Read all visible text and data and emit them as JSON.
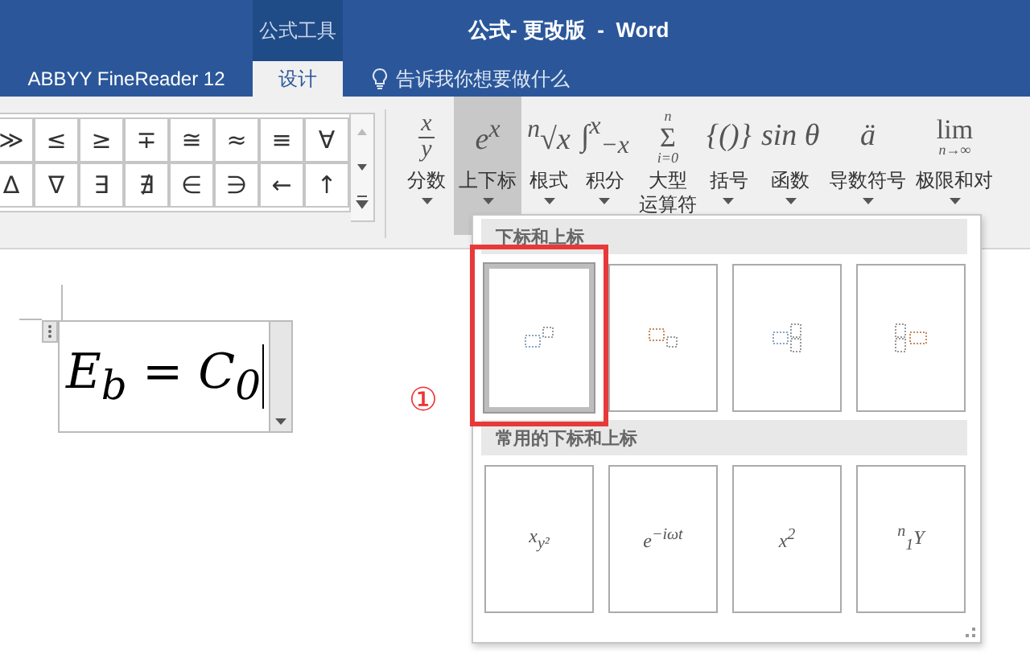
{
  "window": {
    "title": "公式- 更改版  -  Word",
    "context_tab": "公式工具"
  },
  "tabs": [
    {
      "label": "ABBYY FineReader 12",
      "selected": false
    },
    {
      "label": "设计",
      "selected": true
    }
  ],
  "tell_me": {
    "placeholder": "告诉我你想要做什么"
  },
  "symbols": [
    [
      "≫",
      "≤",
      "≥",
      "∓",
      "≅",
      "≈",
      "≡",
      "∀"
    ],
    [
      "∆",
      "∇",
      "∃",
      "∄",
      "∈",
      "∋",
      "←",
      "↑"
    ]
  ],
  "structures": [
    {
      "kind": "fraction",
      "top": "x",
      "bottom": "y",
      "label_lines": [
        "分数"
      ],
      "selected": false
    },
    {
      "kind": "inline",
      "glyph": "e$^{x}$",
      "label_lines": [
        "上下标"
      ],
      "selected": true
    },
    {
      "kind": "inline",
      "glyph": "$^{n}$√x",
      "label_lines": [
        "根式"
      ],
      "selected": false
    },
    {
      "kind": "inline",
      "glyph": "∫$^{x}$$_{−x}$",
      "label_lines": [
        "积分"
      ],
      "selected": false
    },
    {
      "kind": "limits",
      "upper": "n",
      "sign": "Σ",
      "lower": "i=0",
      "label_lines": [
        "大型",
        "运算符"
      ],
      "selected": false
    },
    {
      "kind": "inline",
      "glyph": "{()}",
      "label_lines": [
        "括号"
      ],
      "selected": false
    },
    {
      "kind": "inline",
      "glyph": "sin θ",
      "label_lines": [
        "函数"
      ],
      "selected": false
    },
    {
      "kind": "inline",
      "glyph": "ä",
      "label_lines": [
        "导数符号"
      ],
      "selected": false
    },
    {
      "kind": "limits",
      "sign": "lim",
      "lower": "n→∞",
      "label_lines": [
        "极限和对"
      ],
      "selected": false
    }
  ],
  "equation": "E$_{b}$ = C$_{0}$",
  "marker": "①",
  "dropdown": {
    "sections": [
      {
        "title": "下标和上标",
        "items": [
          {
            "kind": "superscript",
            "selected": true
          },
          {
            "kind": "subscript",
            "selected": false
          },
          {
            "kind": "subsup",
            "selected": false
          },
          {
            "kind": "left-subsup",
            "selected": false
          }
        ]
      },
      {
        "title": "常用的下标和上标",
        "items": [
          {
            "kind": "text",
            "text": "x$_{y²}$",
            "selected": false
          },
          {
            "kind": "text",
            "text": "e$^{−iωt}$",
            "selected": false
          },
          {
            "kind": "text",
            "text": "x$^{2}$",
            "selected": false
          },
          {
            "kind": "text",
            "text": "$^{n}$$_{1}$Y",
            "selected": false
          }
        ]
      }
    ]
  }
}
